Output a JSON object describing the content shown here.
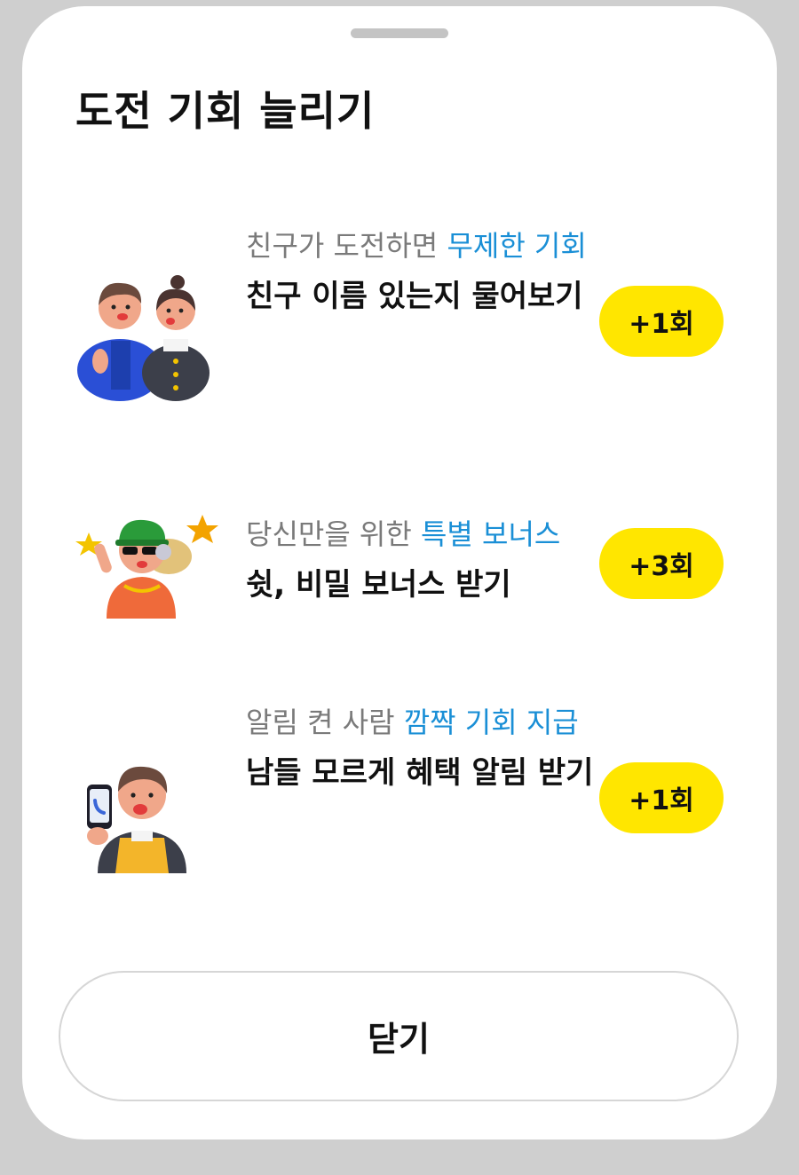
{
  "sheet": {
    "title": "도전 기회 늘리기",
    "close_label": "닫기"
  },
  "colors": {
    "highlight": "#1a8fd6",
    "badge": "#ffe600",
    "background": "#ffffff"
  },
  "items": [
    {
      "sub_prefix": "친구가 도전하면 ",
      "sub_highlight": "무제한 기회",
      "main": "친구 이름 있는지 물어보기",
      "badge": "+1회",
      "icon": "friends-illustration-icon"
    },
    {
      "sub_prefix": "당신만을 위한 ",
      "sub_highlight": "특별 보너스",
      "main": "쉿, 비밀 보너스 받기",
      "badge": "+3회",
      "icon": "cool-character-illustration-icon"
    },
    {
      "sub_prefix": "알림 켠 사람 ",
      "sub_highlight": "깜짝 기회 지급",
      "main": "남들 모르게 혜택 알림 받기",
      "badge": "+1회",
      "icon": "phone-character-illustration-icon"
    }
  ]
}
